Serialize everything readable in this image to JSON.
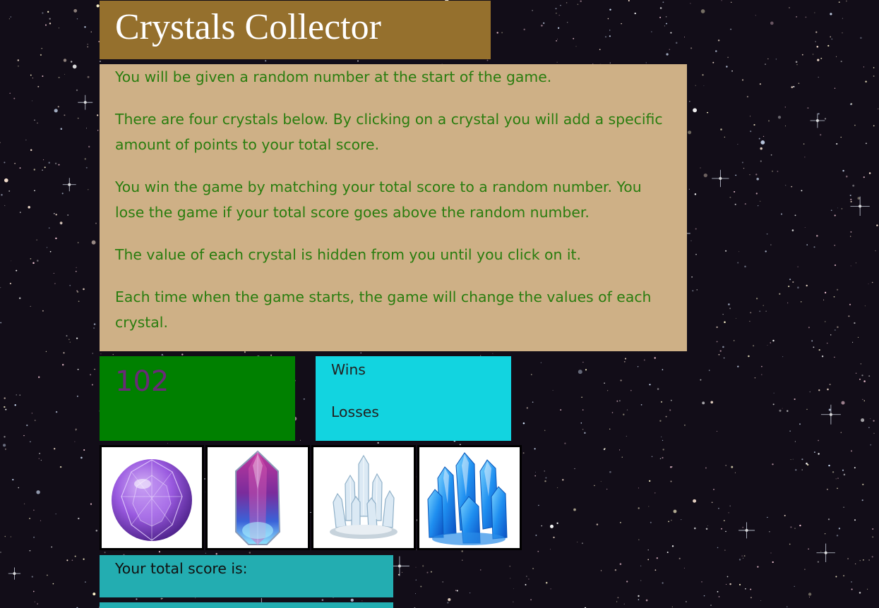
{
  "title": "Crystals Collector",
  "instructions": [
    "You will be given a random number at the start of the game.",
    "There are four crystals below. By clicking on a crystal you will add a specific amount of points to your total score.",
    "You win the game by matching your total score to a random number. You lose the game if your total score goes above the random number.",
    "The value of each crystal is hidden from you until you click on it.",
    "Each time when the game starts, the game will change the values of each crystal."
  ],
  "random_number": "102",
  "stats": {
    "wins_label": "Wins",
    "losses_label": "Losses"
  },
  "crystals": [
    {
      "icon": "purple-round-crystal-icon"
    },
    {
      "icon": "purple-blue-shard-crystal-icon"
    },
    {
      "icon": "clear-quartz-cluster-icon"
    },
    {
      "icon": "blue-crystal-cluster-icon"
    }
  ],
  "score": {
    "label": "Your total score is:"
  },
  "colors": {
    "title_bg": "#95702d",
    "instructions_bg": "#ceb086",
    "instructions_text": "#2a7d0f",
    "target_bg": "#008000",
    "target_text": "#6a2a78",
    "stats_bg": "#12d4e0",
    "score_bg": "#23adb1"
  }
}
